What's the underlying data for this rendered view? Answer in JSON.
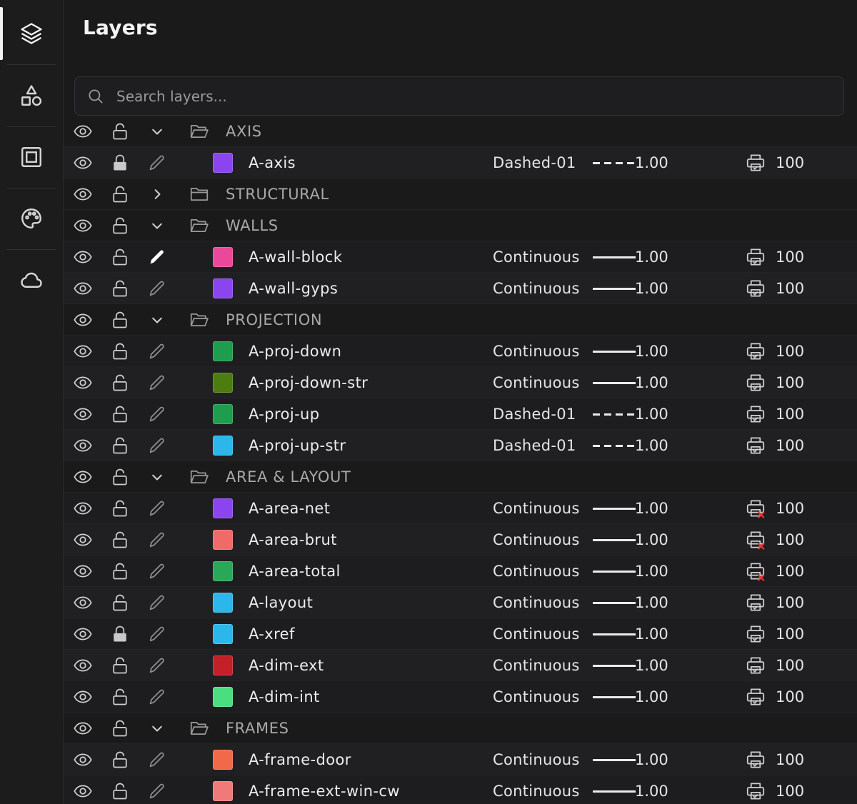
{
  "rail": {
    "items": [
      {
        "icon": "layers-icon",
        "active": true
      },
      {
        "icon": "shapes-icon",
        "active": false
      },
      {
        "icon": "frame-icon",
        "active": false
      },
      {
        "icon": "palette-icon",
        "active": false
      },
      {
        "icon": "cloud-icon",
        "active": false
      }
    ]
  },
  "panel": {
    "title": "Layers",
    "search_placeholder": "Search layers..."
  },
  "colors": {
    "background": "#1a1a1b",
    "row": "#202022",
    "text": "#ececec",
    "muted": "#a9a9a9",
    "print_disabled": "#e5383b"
  },
  "rows": [
    {
      "kind": "group",
      "name": "AXIS",
      "expanded": true
    },
    {
      "kind": "layer",
      "name": "A-axis",
      "color": "#8b45f0",
      "locked": true,
      "editing": false,
      "linetype": "Dashed-01",
      "dashed": true,
      "weight": "1.00",
      "print": true,
      "transparency": "100"
    },
    {
      "kind": "group",
      "name": "STRUCTURAL",
      "expanded": false
    },
    {
      "kind": "group",
      "name": "WALLS",
      "expanded": true
    },
    {
      "kind": "layer",
      "name": "A-wall-block",
      "color": "#ec4899",
      "locked": false,
      "editing": true,
      "linetype": "Continuous",
      "dashed": false,
      "weight": "1.00",
      "print": true,
      "transparency": "100"
    },
    {
      "kind": "layer",
      "name": "A-wall-gyps",
      "color": "#8b45f0",
      "locked": false,
      "editing": false,
      "linetype": "Continuous",
      "dashed": false,
      "weight": "1.00",
      "print": true,
      "transparency": "100"
    },
    {
      "kind": "group",
      "name": "PROJECTION",
      "expanded": true
    },
    {
      "kind": "layer",
      "name": "A-proj-down",
      "color": "#1e9d4e",
      "locked": false,
      "editing": false,
      "linetype": "Continuous",
      "dashed": false,
      "weight": "1.00",
      "print": true,
      "transparency": "100"
    },
    {
      "kind": "layer",
      "name": "A-proj-down-str",
      "color": "#4d7c0f",
      "locked": false,
      "editing": false,
      "linetype": "Continuous",
      "dashed": false,
      "weight": "1.00",
      "print": true,
      "transparency": "100"
    },
    {
      "kind": "layer",
      "name": "A-proj-up",
      "color": "#1e9d4e",
      "locked": false,
      "editing": false,
      "linetype": "Dashed-01",
      "dashed": true,
      "weight": "1.00",
      "print": true,
      "transparency": "100"
    },
    {
      "kind": "layer",
      "name": "A-proj-up-str",
      "color": "#2bb7ea",
      "locked": false,
      "editing": false,
      "linetype": "Dashed-01",
      "dashed": true,
      "weight": "1.00",
      "print": true,
      "transparency": "100"
    },
    {
      "kind": "group",
      "name": "AREA & LAYOUT",
      "expanded": true
    },
    {
      "kind": "layer",
      "name": "A-area-net",
      "color": "#8b45f0",
      "locked": false,
      "editing": false,
      "linetype": "Continuous",
      "dashed": false,
      "weight": "1.00",
      "print": false,
      "transparency": "100"
    },
    {
      "kind": "layer",
      "name": "A-area-brut",
      "color": "#f06a6a",
      "locked": false,
      "editing": false,
      "linetype": "Continuous",
      "dashed": false,
      "weight": "1.00",
      "print": false,
      "transparency": "100"
    },
    {
      "kind": "layer",
      "name": "A-area-total",
      "color": "#2aa85a",
      "locked": false,
      "editing": false,
      "linetype": "Continuous",
      "dashed": false,
      "weight": "1.00",
      "print": false,
      "transparency": "100"
    },
    {
      "kind": "layer",
      "name": "A-layout",
      "color": "#2bb7ea",
      "locked": false,
      "editing": false,
      "linetype": "Continuous",
      "dashed": false,
      "weight": "1.00",
      "print": true,
      "transparency": "100"
    },
    {
      "kind": "layer",
      "name": "A-xref",
      "color": "#2bb7ea",
      "locked": true,
      "editing": false,
      "linetype": "Continuous",
      "dashed": false,
      "weight": "1.00",
      "print": true,
      "transparency": "100"
    },
    {
      "kind": "layer",
      "name": "A-dim-ext",
      "color": "#c4202a",
      "locked": false,
      "editing": false,
      "linetype": "Continuous",
      "dashed": false,
      "weight": "1.00",
      "print": true,
      "transparency": "100"
    },
    {
      "kind": "layer",
      "name": "A-dim-int",
      "color": "#4ade80",
      "locked": false,
      "editing": false,
      "linetype": "Continuous",
      "dashed": false,
      "weight": "1.00",
      "print": true,
      "transparency": "100"
    },
    {
      "kind": "group",
      "name": "FRAMES",
      "expanded": true
    },
    {
      "kind": "layer",
      "name": "A-frame-door",
      "color": "#f06a4a",
      "locked": false,
      "editing": false,
      "linetype": "Continuous",
      "dashed": false,
      "weight": "1.00",
      "print": true,
      "transparency": "100"
    },
    {
      "kind": "layer",
      "name": "A-frame-ext-win-cw",
      "color": "#f07a7a",
      "locked": false,
      "editing": false,
      "linetype": "Continuous",
      "dashed": false,
      "weight": "1.00",
      "print": true,
      "transparency": "100"
    }
  ]
}
